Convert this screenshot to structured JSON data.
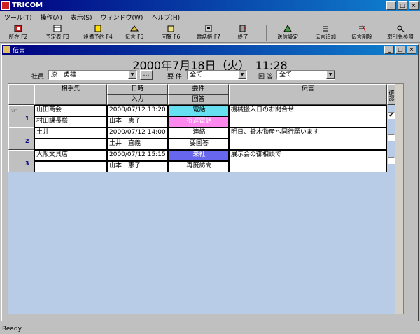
{
  "app": {
    "title": "TRICOM"
  },
  "menu": [
    "ツール(T)",
    "操作(A)",
    "表示(S)",
    "ウィンドウ(W)",
    "ヘルプ(H)"
  ],
  "toolbar": [
    {
      "label": "所在 F2",
      "icon": "location-icon"
    },
    {
      "label": "予定表 F3",
      "icon": "schedule-icon"
    },
    {
      "label": "設備予約 F4",
      "icon": "equipment-icon"
    },
    {
      "label": "伝言 F5",
      "icon": "message-icon"
    },
    {
      "label": "回覧 F6",
      "icon": "circulation-icon"
    },
    {
      "label": "電話帳 F7",
      "icon": "phonebook-icon"
    },
    {
      "label": "終了",
      "icon": "exit-icon"
    },
    {
      "label": "送信設定",
      "icon": "send-settings-icon"
    },
    {
      "label": "伝言追加",
      "icon": "add-message-icon"
    },
    {
      "label": "伝言削除",
      "icon": "delete-message-icon"
    },
    {
      "label": "取引先参照",
      "icon": "client-lookup-icon"
    }
  ],
  "window": {
    "title": "伝言"
  },
  "datetime": "2000年7月18日（火）　11:28",
  "filters": {
    "employee_label": "社員",
    "employee_value": "原　勇雄",
    "dots": "…",
    "subject_label": "要 件",
    "subject_value": "全て",
    "reply_label": "回 答",
    "reply_value": "全て"
  },
  "headers": {
    "partner": "相手先",
    "datetime": "日時",
    "input": "入力",
    "subject": "要件",
    "reply": "回答",
    "message": "伝言",
    "confirm": "確認"
  },
  "rows": [
    {
      "num": "1",
      "company": "山田商会",
      "contact": "村田課長様",
      "datetime": "2000/07/12 13:20",
      "inputter": "山本　恵子",
      "subject": "電話",
      "reply": "折返電話",
      "message": "機械搬入日のお問合せ",
      "confirmed": "✔"
    },
    {
      "num": "2",
      "company": "土井",
      "contact": "",
      "datetime": "2000/07/12 14:00",
      "inputter": "土井　直義",
      "subject": "連絡",
      "reply": "要回答",
      "message": "明日、鈴木物産へ同行願います",
      "confirmed": ""
    },
    {
      "num": "3",
      "company": "大阪文具店",
      "contact": "",
      "datetime": "2000/07/12 15:15",
      "inputter": "山本　恵子",
      "subject": "来社",
      "reply": "再度訪問",
      "message": "展示会の御相談で",
      "confirmed": ""
    }
  ],
  "colors": {
    "phone": "#66e0f0",
    "callback": "#ff88ee",
    "visit": "#6666ee"
  },
  "status": "Ready"
}
